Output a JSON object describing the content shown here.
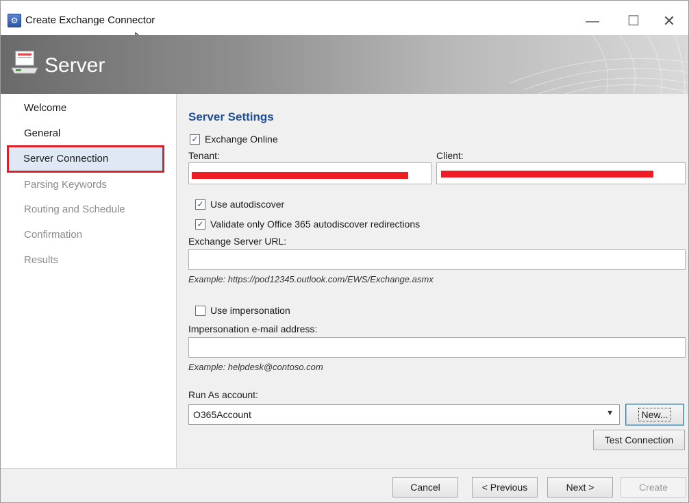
{
  "window": {
    "title": "Create Exchange Connector",
    "controls": {
      "minimize": "—",
      "maximize": "☐",
      "close": "✕"
    }
  },
  "banner": {
    "title": "Server",
    "icon": "server-wizard-icon"
  },
  "nav": {
    "items": [
      {
        "label": "Welcome",
        "state": "completed"
      },
      {
        "label": "General",
        "state": "completed"
      },
      {
        "label": "Server Connection",
        "state": "active"
      },
      {
        "label": "Parsing Keywords",
        "state": "disabled"
      },
      {
        "label": "Routing and Schedule",
        "state": "disabled"
      },
      {
        "label": "Confirmation",
        "state": "disabled"
      },
      {
        "label": "Results",
        "state": "disabled"
      }
    ]
  },
  "form": {
    "section_title": "Server Settings",
    "exchange_online": {
      "label": "Exchange Online",
      "checked": true
    },
    "tenant": {
      "label": "Tenant:",
      "value": ""
    },
    "client": {
      "label": "Client:",
      "value": ""
    },
    "use_autodiscover": {
      "label": "Use autodiscover",
      "checked": true
    },
    "validate_o365": {
      "label": "Validate only Office 365 autodiscover redirections",
      "checked": true
    },
    "server_url": {
      "label": "Exchange Server URL:",
      "value": "",
      "example": "Example: https://pod12345.outlook.com/EWS/Exchange.asmx"
    },
    "use_impersonation": {
      "label": "Use impersonation",
      "checked": false
    },
    "impersonation_email": {
      "label": "Impersonation e-mail address:",
      "value": "",
      "example": "Example: helpdesk@contoso.com"
    },
    "run_as": {
      "label": "Run As account:",
      "selected": "O365Account"
    },
    "new_button": "New...",
    "test_button": "Test Connection"
  },
  "footer": {
    "cancel": "Cancel",
    "previous": "< Previous",
    "next": "Next >",
    "create": "Create"
  },
  "colors": {
    "accent": "#1f4f9a",
    "highlight_outline": "#d9222a",
    "redaction": "#ef1c24",
    "nav_active_bg": "#dfe9f6"
  }
}
